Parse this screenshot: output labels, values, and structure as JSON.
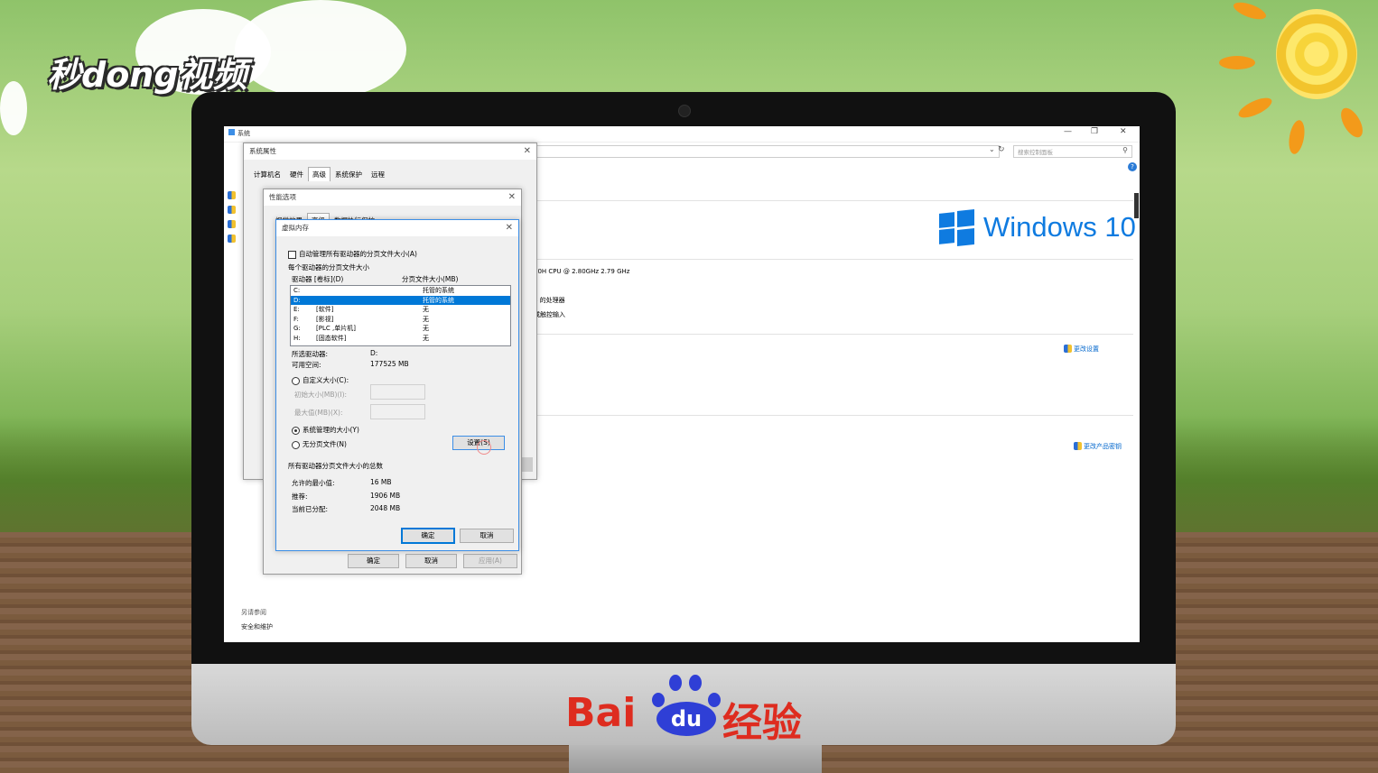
{
  "watermark": {
    "logo": "秒dong视频"
  },
  "baidu": {
    "left": "Bai",
    "paw": "du",
    "right": "经验"
  },
  "desktop": {
    "title": "系统",
    "search_placeholder": "搜索控制面板",
    "win10_label": "Windows 10",
    "cpu_text": "00H CPU @ 2.80GHz   2.79 GHz",
    "proc_text": "4 的处理器",
    "touch_text": "或触控输入",
    "change_settings": "更改设置",
    "change_key": "更改产品密钥",
    "see_also": "另请参阅",
    "security": "安全和维护"
  },
  "sysprops": {
    "title": "系统属性",
    "tabs": [
      "计算机名",
      "硬件",
      "高级",
      "系统保护",
      "远程"
    ],
    "ok": "确定",
    "cancel": "取消",
    "apply": "应用(A)"
  },
  "perf": {
    "title": "性能选项",
    "tabs": [
      "视觉效果",
      "高级",
      "数据执行保护"
    ]
  },
  "vm": {
    "title": "虚拟内存",
    "auto_manage": "自动管理所有驱动器的分页文件大小(A)",
    "per_drive": "每个驱动器的分页文件大小",
    "col_drive": "驱动器 [卷标](D)",
    "col_size": "分页文件大小(MB)",
    "drives": [
      {
        "d": "C:",
        "label": "",
        "size": "托管的系统"
      },
      {
        "d": "D:",
        "label": "",
        "size": "托管的系统"
      },
      {
        "d": "E:",
        "label": "[软件]",
        "size": "无"
      },
      {
        "d": "F:",
        "label": "[影视]",
        "size": "无"
      },
      {
        "d": "G:",
        "label": "[PLC ,单片机]",
        "size": "无"
      },
      {
        "d": "H:",
        "label": "[固态软件]",
        "size": "无"
      }
    ],
    "sel_drive_lbl": "所选驱动器:",
    "sel_drive_val": "D:",
    "free_lbl": "可用空间:",
    "free_val": "177525 MB",
    "custom": "自定义大小(C):",
    "initial": "初始大小(MB)(I):",
    "maximum": "最大值(MB)(X):",
    "system_managed": "系统管理的大小(Y)",
    "no_paging": "无分页文件(N)",
    "set_btn": "设置(S)",
    "total_title": "所有驱动器分页文件大小的总数",
    "min_lbl": "允许的最小值:",
    "min_val": "16 MB",
    "rec_lbl": "推荐:",
    "rec_val": "1906 MB",
    "cur_lbl": "当前已分配:",
    "cur_val": "2048 MB",
    "ok": "确定",
    "cancel": "取消"
  },
  "colors": {
    "accent": "#0078d7",
    "baidu_red": "#de2c1f",
    "baidu_blue": "#2f3fd6"
  }
}
